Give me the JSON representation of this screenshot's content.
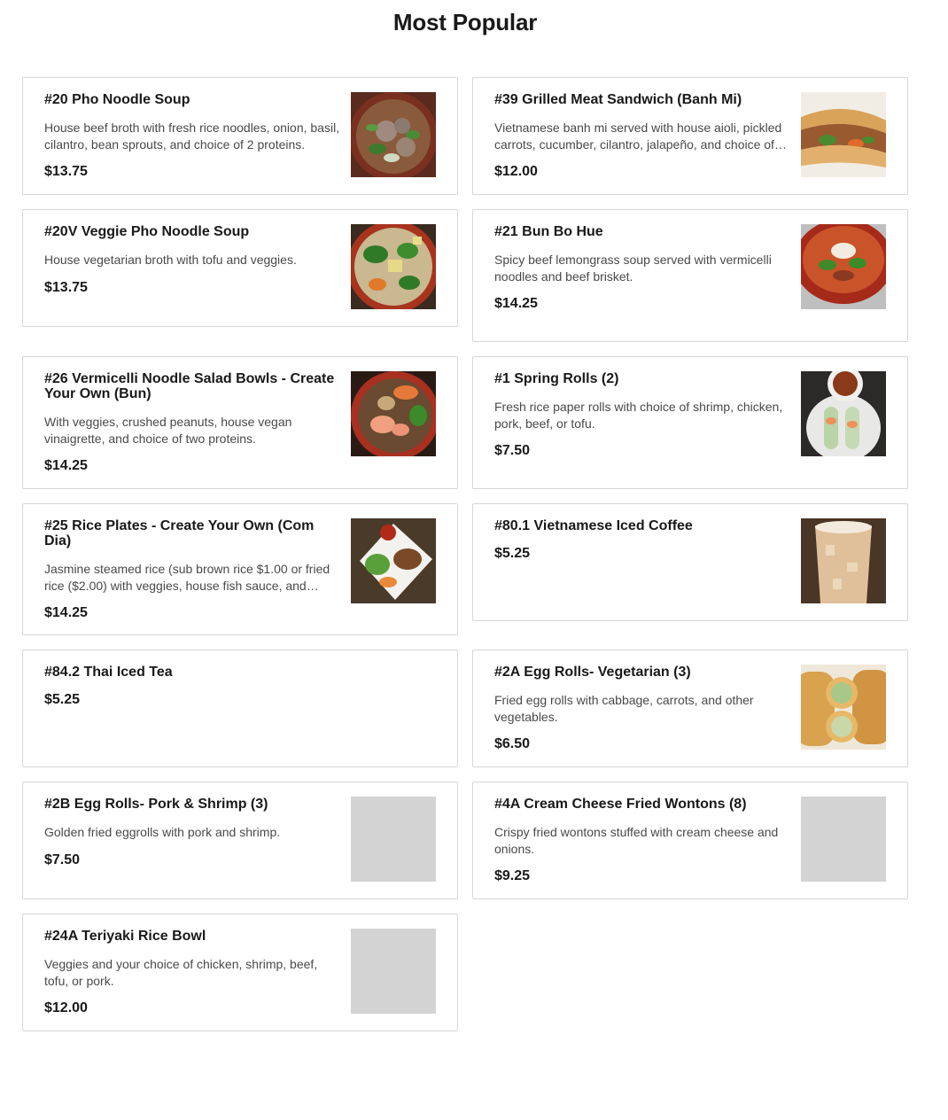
{
  "section": {
    "title": "Most Popular"
  },
  "items": [
    {
      "name": "#20 Pho Noodle Soup",
      "description": "House beef broth with fresh rice noodles, onion, basil, cilantro, bean sprouts, and choice of 2 proteins.",
      "price": "$13.75",
      "image": "pho-noodle-soup-photo"
    },
    {
      "name": "#39 Grilled Meat Sandwich (Banh Mi)",
      "description": "Vietnamese banh mi served with house aioli, pickled carrots, cucumber, cilantro, jalapeño, and choice of protein.",
      "price": "$12.00",
      "image": "banh-mi-photo"
    },
    {
      "name": "#20V Veggie Pho Noodle Soup",
      "description": "House vegetarian broth with tofu and veggies.",
      "price": "$13.75",
      "image": "veggie-pho-photo"
    },
    {
      "name": "#21 Bun Bo Hue",
      "description": "Spicy beef lemongrass soup served with vermicelli noodles and beef brisket.",
      "price": "$14.25",
      "image": "bun-bo-hue-photo"
    },
    {
      "name": "#26 Vermicelli Noodle Salad Bowls - Create Your Own (Bun)",
      "description": "With veggies, crushed peanuts, house vegan vinaigrette, and choice of two proteins.",
      "price": "$14.25",
      "image": "vermicelli-bowl-photo"
    },
    {
      "name": "#1 Spring Rolls (2)",
      "description": "Fresh rice paper rolls with choice of shrimp, chicken, pork, beef, or tofu.",
      "price": "$7.50",
      "image": "spring-rolls-photo"
    },
    {
      "name": "#25 Rice Plates - Create Your Own (Com Dia)",
      "description": "Jasmine steamed rice (sub brown rice $1.00 or fried rice ($2.00) with veggies, house fish sauce, and choice of protein.",
      "price": "$14.25",
      "image": "rice-plate-photo"
    },
    {
      "name": "#80.1 Vietnamese Iced Coffee",
      "description": "",
      "price": "$5.25",
      "image": "iced-coffee-photo"
    },
    {
      "name": "#84.2 Thai Iced Tea",
      "description": "",
      "price": "$5.25",
      "image": ""
    },
    {
      "name": "#2A Egg Rolls- Vegetarian (3)",
      "description": "Fried egg rolls with cabbage, carrots, and other vegetables.",
      "price": "$6.50",
      "image": "egg-rolls-photo"
    },
    {
      "name": "#2B Egg Rolls- Pork & Shrimp (3)",
      "description": "Golden fried eggrolls with pork and shrimp.",
      "price": "$7.50",
      "image": "placeholder"
    },
    {
      "name": "#4A Cream Cheese Fried Wontons (8)",
      "description": "Crispy fried wontons stuffed with cream cheese and onions.",
      "price": "$9.25",
      "image": "placeholder"
    },
    {
      "name": "#24A Teriyaki Rice Bowl",
      "description": "Veggies and your choice of chicken, shrimp, beef, tofu, or pork.",
      "price": "$12.00",
      "image": "placeholder"
    }
  ],
  "colors": {
    "text": "#191919",
    "description": "#494949",
    "border": "#d6d6d6",
    "placeholder": "#d3d3d3"
  }
}
